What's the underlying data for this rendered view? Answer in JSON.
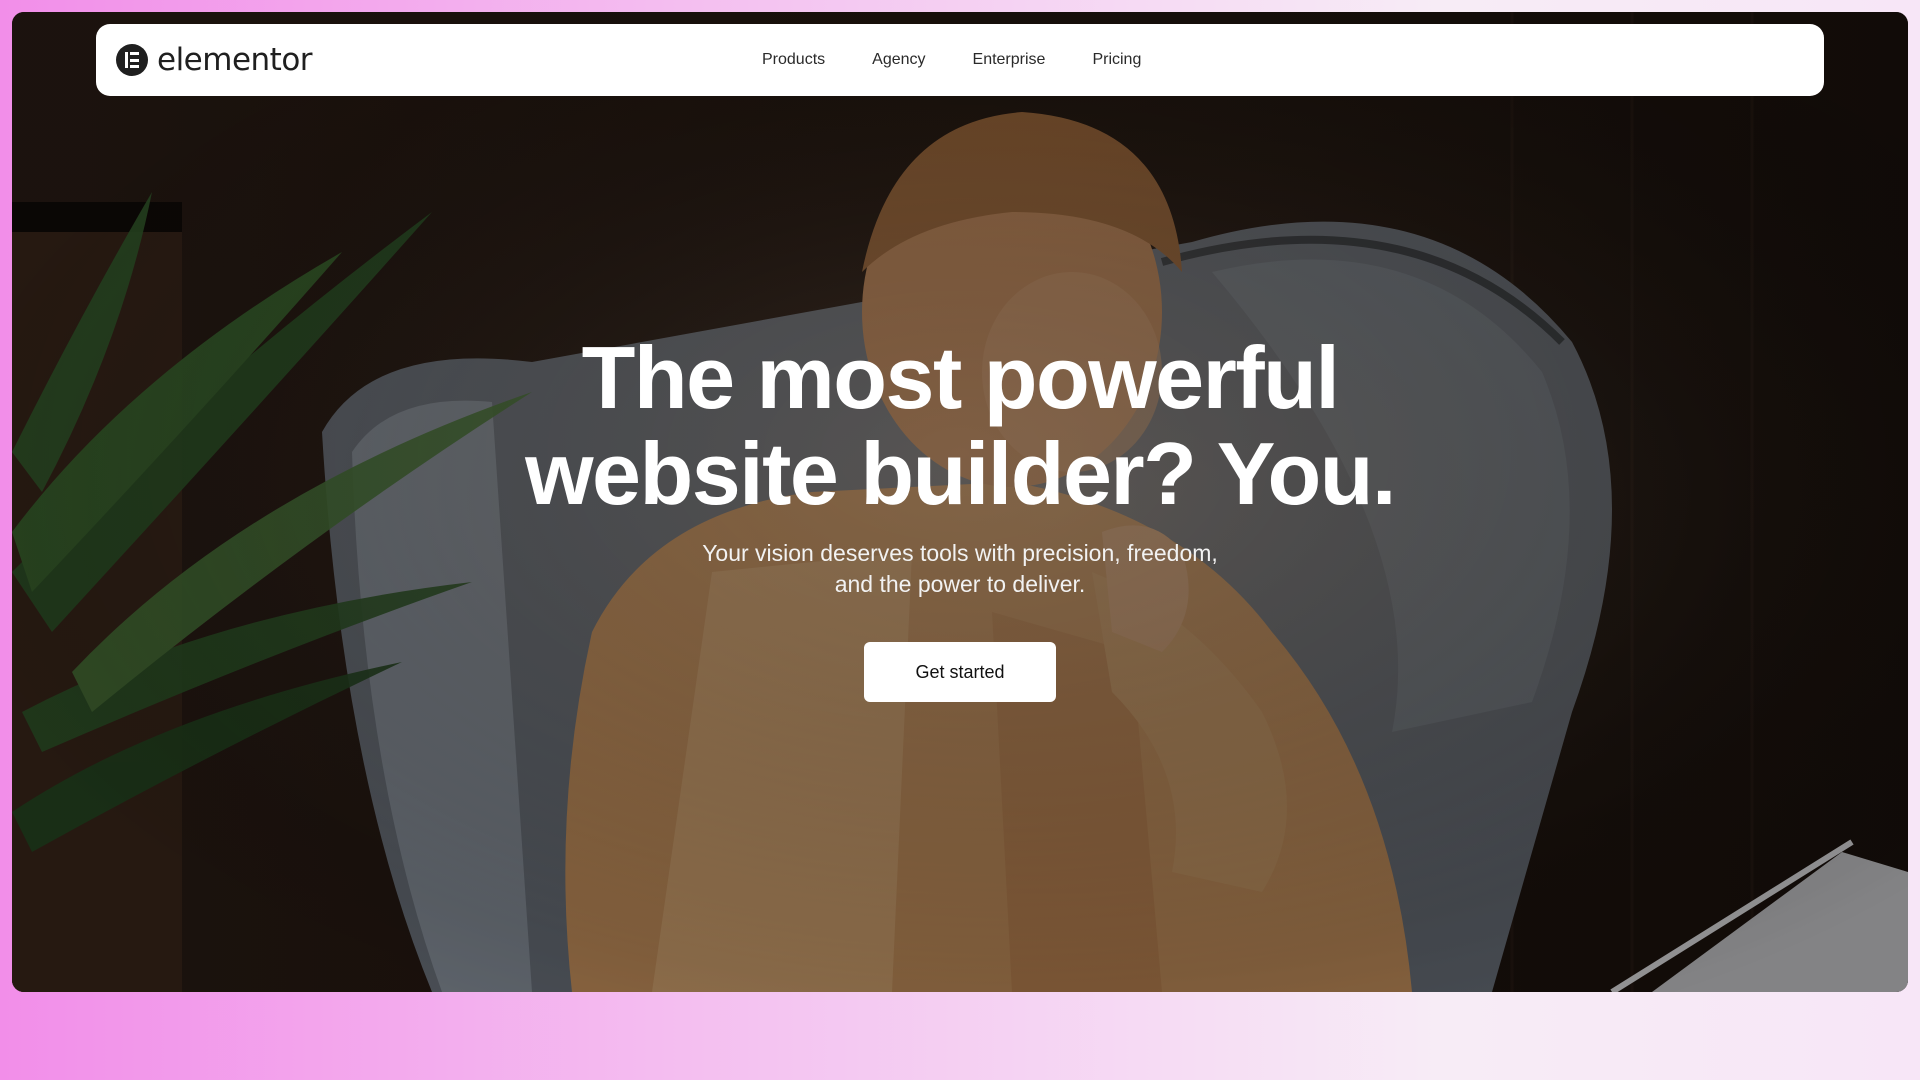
{
  "brand": {
    "name": "elementor",
    "logo_icon": "elementor-e-logo-icon"
  },
  "nav": {
    "items": [
      {
        "label": "Products"
      },
      {
        "label": "Agency"
      },
      {
        "label": "Enterprise"
      },
      {
        "label": "Pricing"
      }
    ]
  },
  "hero": {
    "headline_line1": "The most powerful",
    "headline_line2": "website builder? You.",
    "subhead_line1": "Your vision deserves tools with precision, freedom,",
    "subhead_line2": "and the power to deliver.",
    "cta_label": "Get started"
  },
  "colors": {
    "page_gradient_start": "#f28ee9",
    "page_gradient_end": "#f7e6f7",
    "nav_background": "#ffffff",
    "hero_text": "#ffffff"
  }
}
